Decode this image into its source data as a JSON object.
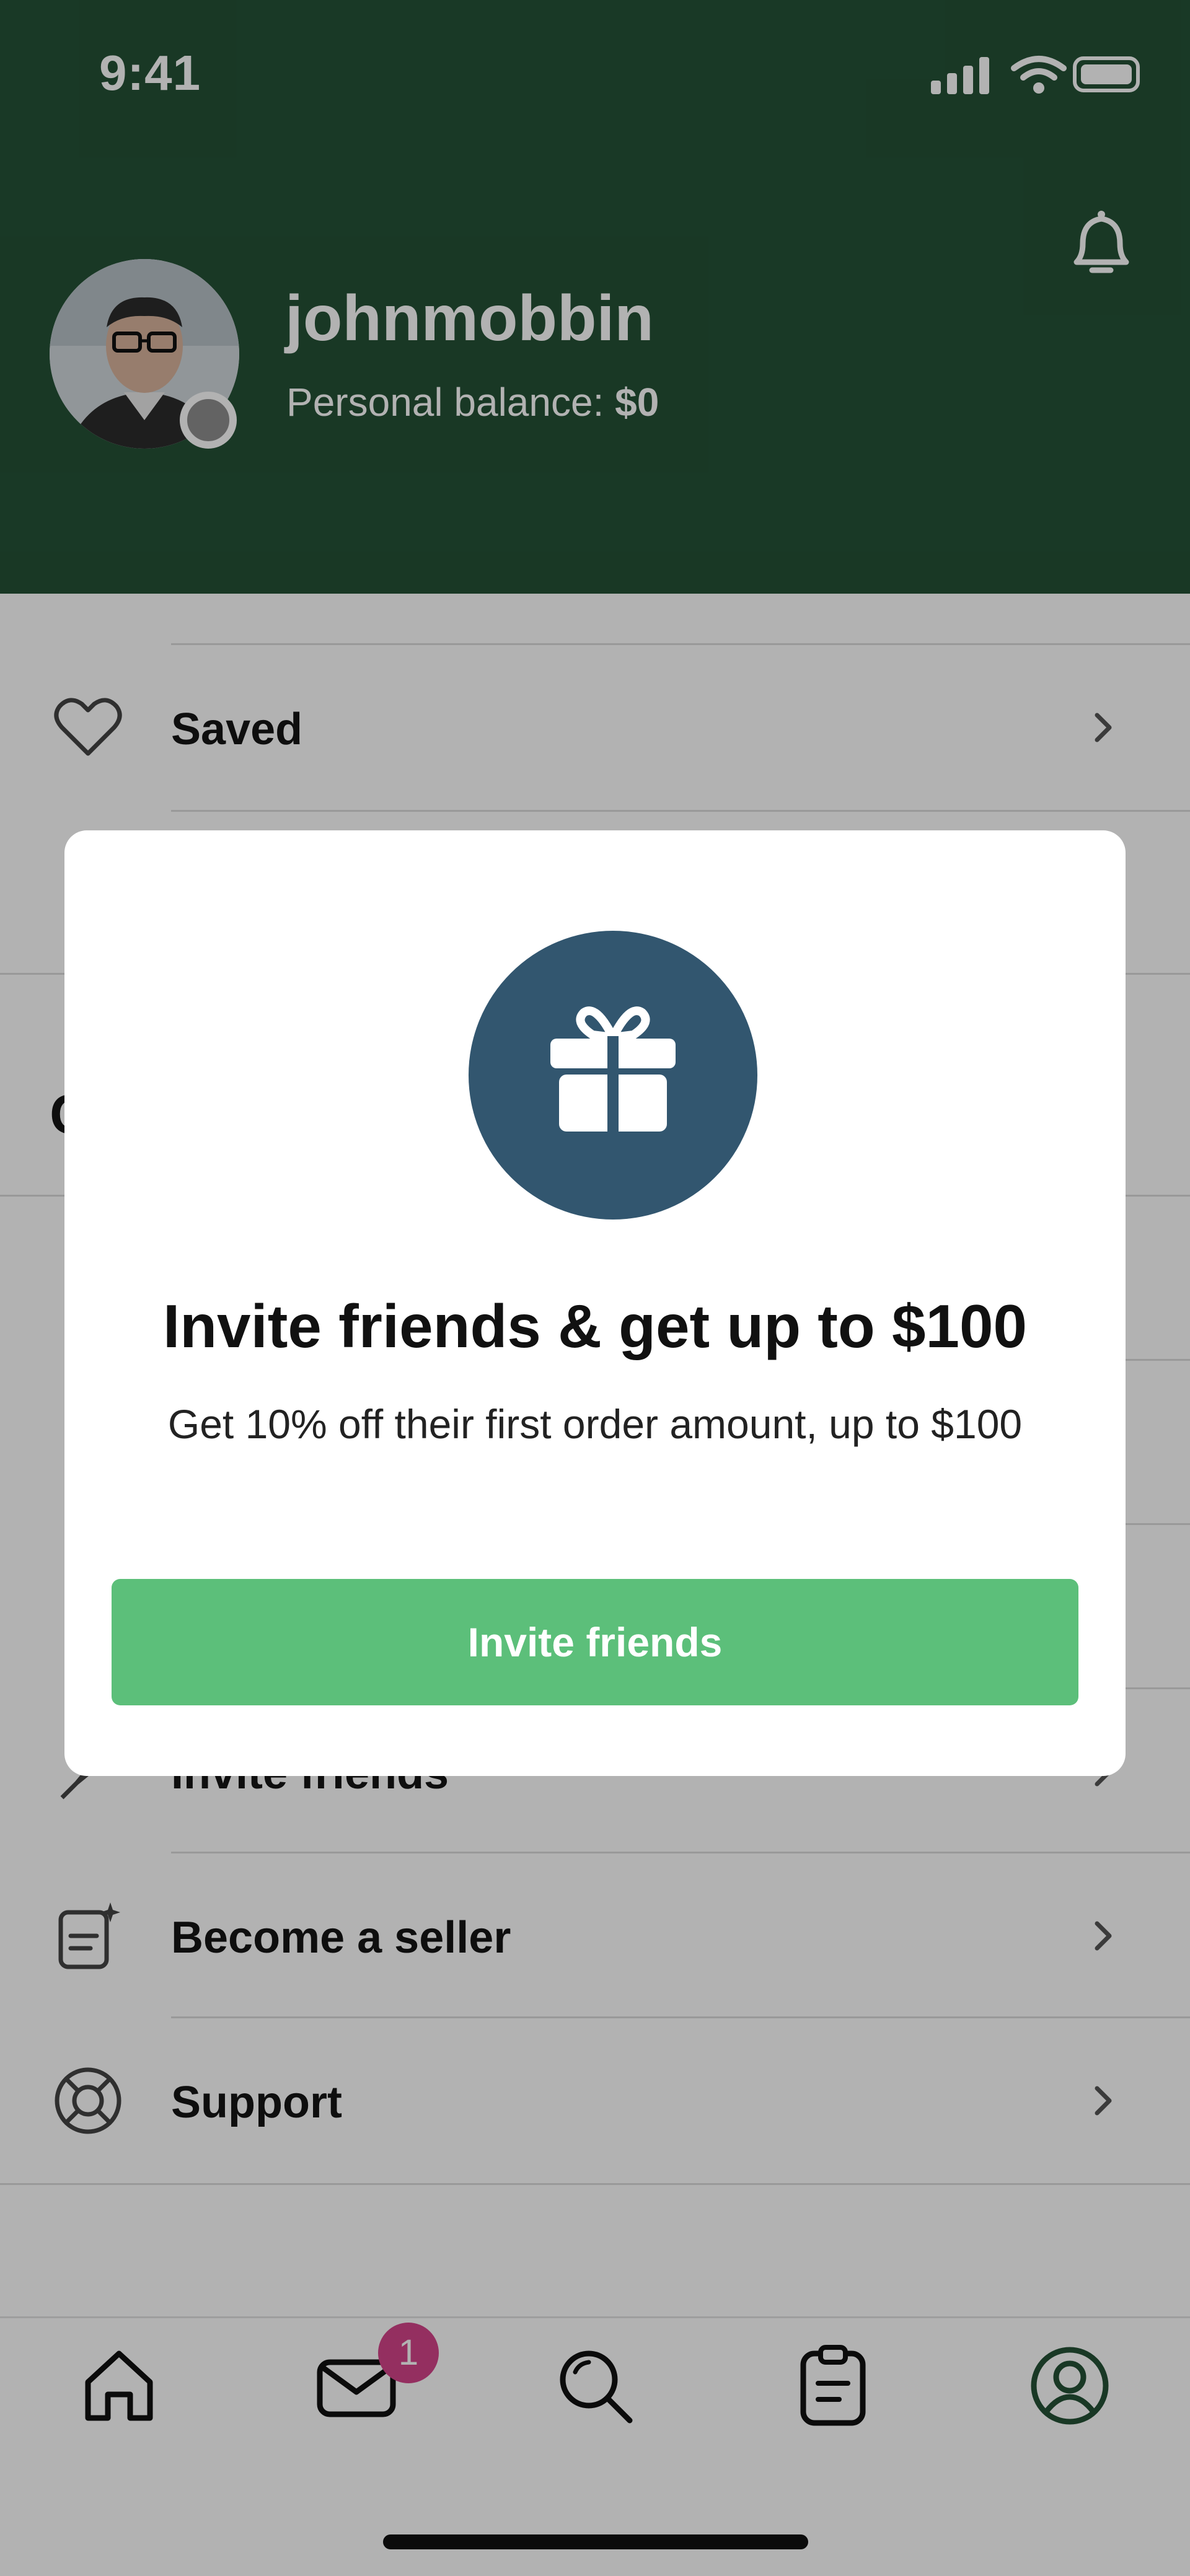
{
  "status_bar": {
    "time": "9:41"
  },
  "profile": {
    "username": "johnmobbin",
    "balance_label": "Personal balance: ",
    "balance_value": "$0"
  },
  "menu": {
    "items": [
      {
        "label": "Saved",
        "icon": "heart-icon"
      },
      {
        "label": "Invite friends",
        "icon": "rocket-icon"
      },
      {
        "label": "Become a seller",
        "icon": "clipboard-sparkle-icon"
      },
      {
        "label": "Support",
        "icon": "lifebuoy-icon"
      }
    ],
    "section_letter": "C"
  },
  "modal": {
    "title": "Invite friends & get up to $100",
    "subtitle": "Get 10% off their first order amount, up to $100",
    "button_label": "Invite friends",
    "icon": "gift-icon"
  },
  "tabbar": {
    "tabs": [
      "home-icon",
      "inbox-icon",
      "search-icon",
      "orders-icon",
      "profile-icon"
    ],
    "inbox_badge": "1",
    "active_color": "#245136"
  },
  "colors": {
    "header": "#245136",
    "primary_button": "#5cbf7a",
    "gift_circle": "#32566f",
    "badge": "#d4448a"
  }
}
